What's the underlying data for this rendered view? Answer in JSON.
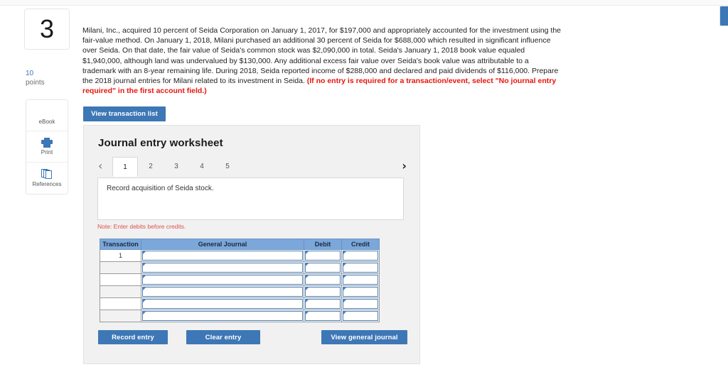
{
  "question": {
    "number": "3",
    "points_value": "10",
    "points_label": "points"
  },
  "rail": {
    "items": [
      {
        "label": "eBook",
        "icon": "book-icon"
      },
      {
        "label": "Print",
        "icon": "printer-icon"
      },
      {
        "label": "References",
        "icon": "references-icon"
      }
    ]
  },
  "problem": {
    "body": "Milani, Inc., acquired 10 percent of Seida Corporation on January 1, 2017, for $197,000 and appropriately accounted for the investment using the fair-value method.  On January 1, 2018, Milani purchased an additional 30 percent of Seida for $688,000 which resulted in significant influence over Seida. On that date, the fair value of Seida's common stock was $2,090,000 in total. Seida's January 1, 2018 book value equaled $1,940,000, although land was undervalued by $130,000. Any additional excess fair value over Seida's book value was attributable to a trademark with an 8-year remaining life. During 2018, Seida reported income of $288,000 and declared and paid dividends of $116,000. Prepare the 2018 journal entries for Milani related to its investment in Seida. ",
    "requirement": "(If no entry is required for a transaction/event, select \"No journal entry required\" in the first account field.)"
  },
  "toolbar": {
    "view_transaction_list": "View transaction list"
  },
  "worksheet": {
    "title": "Journal entry worksheet",
    "prev_icon": "chevron-left-icon",
    "next_icon": "chevron-right-icon",
    "tabs": [
      {
        "label": "1",
        "active": true
      },
      {
        "label": "2",
        "active": false
      },
      {
        "label": "3",
        "active": false
      },
      {
        "label": "4",
        "active": false
      },
      {
        "label": "5",
        "active": false
      }
    ],
    "description": "Record acquisition of Seida stock.",
    "note": "Note: Enter debits before credits."
  },
  "journal_table": {
    "headers": [
      "Transaction",
      "General Journal",
      "Debit",
      "Credit"
    ],
    "rows": [
      {
        "transaction": "1",
        "general_journal": "",
        "debit": "",
        "credit": ""
      },
      {
        "transaction": "",
        "general_journal": "",
        "debit": "",
        "credit": ""
      },
      {
        "transaction": "",
        "general_journal": "",
        "debit": "",
        "credit": ""
      },
      {
        "transaction": "",
        "general_journal": "",
        "debit": "",
        "credit": ""
      },
      {
        "transaction": "",
        "general_journal": "",
        "debit": "",
        "credit": ""
      },
      {
        "transaction": "",
        "general_journal": "",
        "debit": "",
        "credit": ""
      }
    ]
  },
  "actions": {
    "record_entry": "Record entry",
    "clear_entry": "Clear entry",
    "view_general_journal": "View general journal"
  },
  "colors": {
    "accent_blue": "#3d77b6",
    "table_header_blue": "#7ba7db",
    "input_border_blue": "#4a80bd",
    "alert_red": "#e8140c",
    "note_red": "#d9534f",
    "panel_gray": "#f1f1f1"
  }
}
